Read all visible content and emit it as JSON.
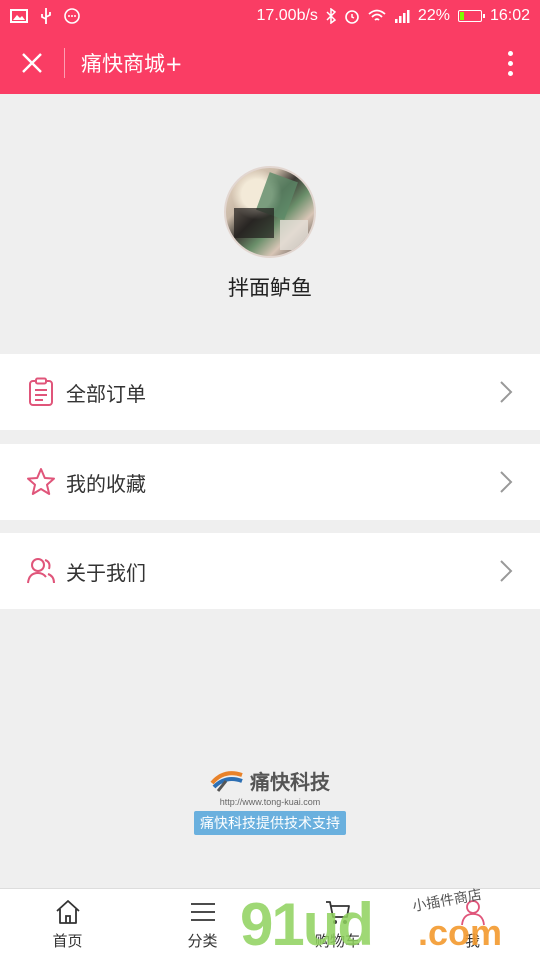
{
  "status_bar": {
    "speed": "17.00b/s",
    "battery": "22%",
    "battery_level": 0.22,
    "time": "16:02"
  },
  "header": {
    "title": "痛快商城+"
  },
  "profile": {
    "username": "拌面鲈鱼"
  },
  "menu": [
    {
      "label": "全部订单",
      "icon": "clipboard-icon"
    },
    {
      "label": "我的收藏",
      "icon": "star-icon"
    },
    {
      "label": "关于我们",
      "icon": "users-icon"
    }
  ],
  "brand": {
    "name": "痛快科技",
    "url": "http://www.tong-kuai.com",
    "support": "痛快科技提供技术支持"
  },
  "tabs": [
    {
      "label": "首页",
      "icon": "home-icon"
    },
    {
      "label": "分类",
      "icon": "list-icon"
    },
    {
      "label": "购物车",
      "icon": "cart-icon"
    },
    {
      "label": "我",
      "icon": "person-icon"
    }
  ],
  "watermark": {
    "big": "91ud",
    "com": ".com",
    "small": "小插件商店"
  },
  "colors": {
    "accent": "#fa3d64",
    "icon": "#e0557a"
  }
}
